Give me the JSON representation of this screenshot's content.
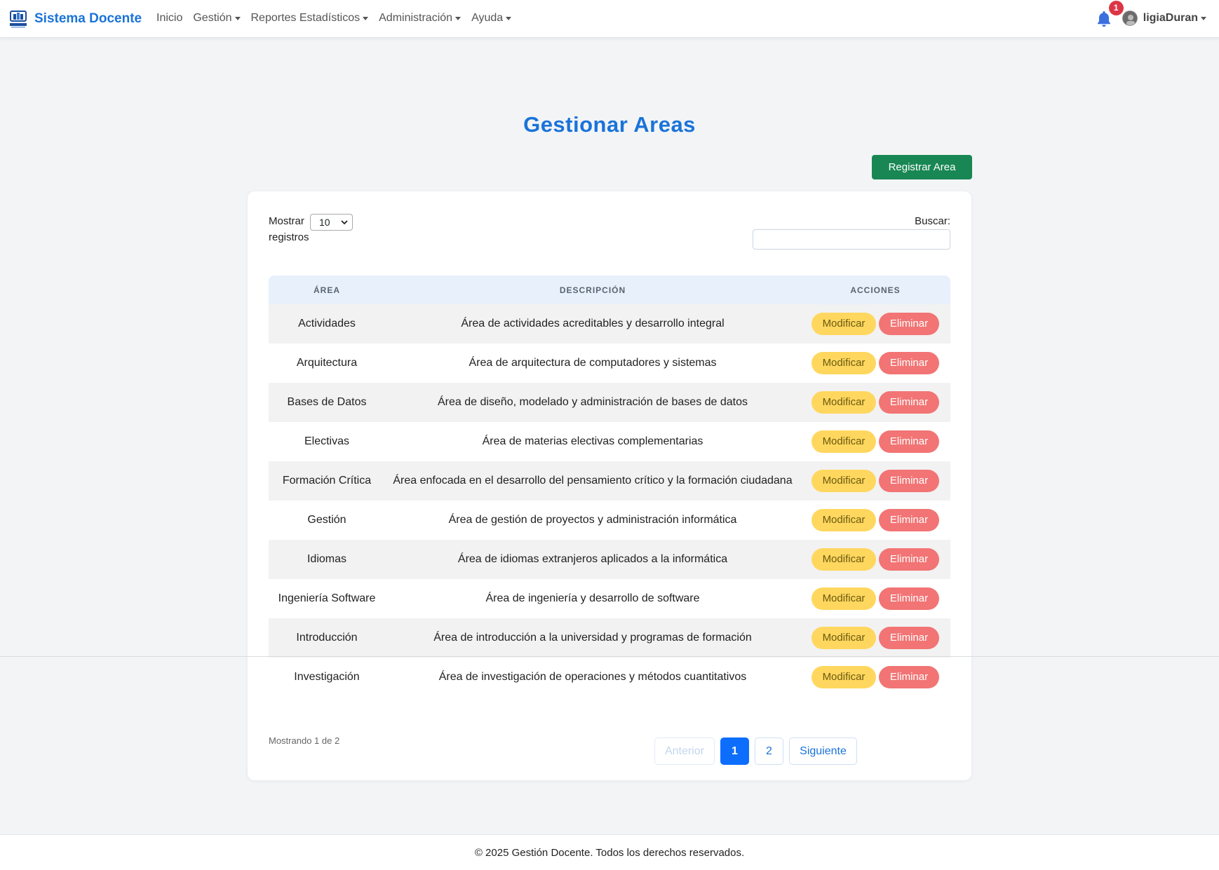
{
  "navbar": {
    "brand": "Sistema Docente",
    "logo_icon": "university-logo-icon",
    "links": [
      {
        "label": "Inicio",
        "dropdown": false
      },
      {
        "label": "Gestión",
        "dropdown": true
      },
      {
        "label": "Reportes Estadísticos",
        "dropdown": true
      },
      {
        "label": "Administración",
        "dropdown": true
      },
      {
        "label": "Ayuda",
        "dropdown": true
      }
    ],
    "notification_count": "1",
    "username": "ligiaDuran"
  },
  "page": {
    "title": "Gestionar Areas",
    "register_button": "Registrar Area"
  },
  "table_controls": {
    "length_label": "Mostrar",
    "length_value": "10",
    "length_suffix": "registros",
    "search_label": "Buscar:",
    "search_value": ""
  },
  "table": {
    "headers": [
      "ÁREA",
      "DESCRIPCIÓN",
      "ACCIONES"
    ],
    "rows": [
      {
        "area": "Actividades",
        "descripcion": "Área de actividades acreditables y desarrollo integral"
      },
      {
        "area": "Arquitectura",
        "descripcion": "Área de arquitectura de computadores y sistemas"
      },
      {
        "area": "Bases de Datos",
        "descripcion": "Área de diseño, modelado y administración de bases de datos"
      },
      {
        "area": "Electivas",
        "descripcion": "Área de materias electivas complementarias"
      },
      {
        "area": "Formación Crítica",
        "descripcion": "Área enfocada en el desarrollo del pensamiento crítico y la formación ciudadana"
      },
      {
        "area": "Gestión",
        "descripcion": "Área de gestión de proyectos y administración informática"
      },
      {
        "area": "Idiomas",
        "descripcion": "Área de idiomas extranjeros aplicados a la informática"
      },
      {
        "area": "Ingeniería Software",
        "descripcion": "Área de ingeniería y desarrollo de software"
      },
      {
        "area": "Introducción",
        "descripcion": "Área de introducción a la universidad y programas de formación"
      },
      {
        "area": "Investigación",
        "descripcion": "Área de investigación de operaciones y métodos cuantitativos"
      }
    ],
    "modify_label": "Modificar",
    "delete_label": "Eliminar"
  },
  "pagination": {
    "info": "Mostrando 1 de 2",
    "prev": "Anterior",
    "pages": [
      "1",
      "2"
    ],
    "next": "Siguiente"
  },
  "footer": {
    "text": "© 2025 Gestión Docente. Todos los derechos reservados."
  },
  "colors": {
    "brand_blue": "#1a73d9",
    "success_green": "#198754",
    "modify_yellow": "#ffd75e",
    "delete_red": "#f27474",
    "badge_red": "#dc3545"
  }
}
